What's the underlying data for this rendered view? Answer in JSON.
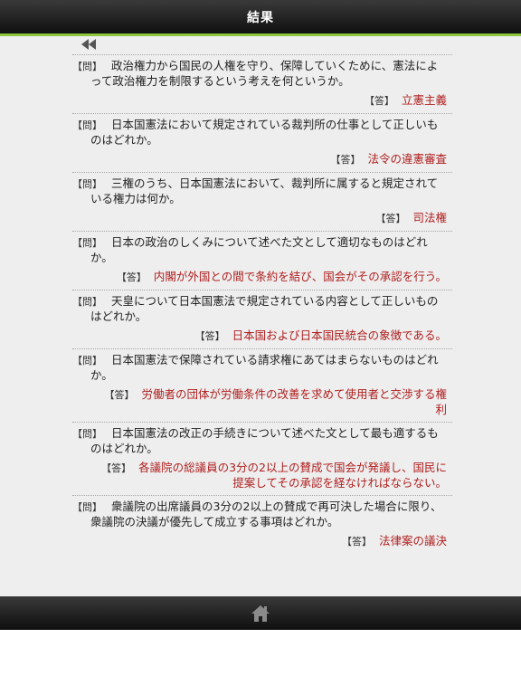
{
  "header": {
    "title": "結果"
  },
  "labels": {
    "question_tag": "【問】",
    "answer_tag": "【答】"
  },
  "qa": [
    {
      "q": "政治権力から国民の人権を守り、保障していくために、憲法によって政治権力を制限するという考えを何というか。",
      "a": "立憲主義"
    },
    {
      "q": "日本国憲法において規定されている裁判所の仕事として正しいものはどれか。",
      "a": "法令の違憲審査"
    },
    {
      "q": "三権のうち、日本国憲法において、裁判所に属すると規定されている権力は何か。",
      "a": "司法権"
    },
    {
      "q": "日本の政治のしくみについて述べた文として適切なものはどれか。",
      "a": "内閣が外国との間で条約を結び、国会がその承認を行う。"
    },
    {
      "q": "天皇について日本国憲法で規定されている内容として正しいものはどれか。",
      "a": "日本国および日本国民統合の象徴である。"
    },
    {
      "q": "日本国憲法で保障されている請求権にあてはまらないものはどれか。",
      "a": "労働者の団体が労働条件の改善を求めて使用者と交渉する権利"
    },
    {
      "q": "日本国憲法の改正の手続きについて述べた文として最も適するものはどれか。",
      "a": "各議院の総議員の3分の2以上の賛成で国会が発議し、国民に提案してその承認を経なければならない。"
    },
    {
      "q": "衆議院の出席議員の3分の2以上の賛成で再可決した場合に限り、衆議院の決議が優先して成立する事項はどれか。",
      "a": "法律案の議決"
    }
  ],
  "icons": {
    "back": "double-chevron-left-icon",
    "home": "home-icon"
  },
  "colors": {
    "accent": "#8cc63f",
    "answer": "#b01e1e",
    "bar": "#1a1a1a"
  }
}
